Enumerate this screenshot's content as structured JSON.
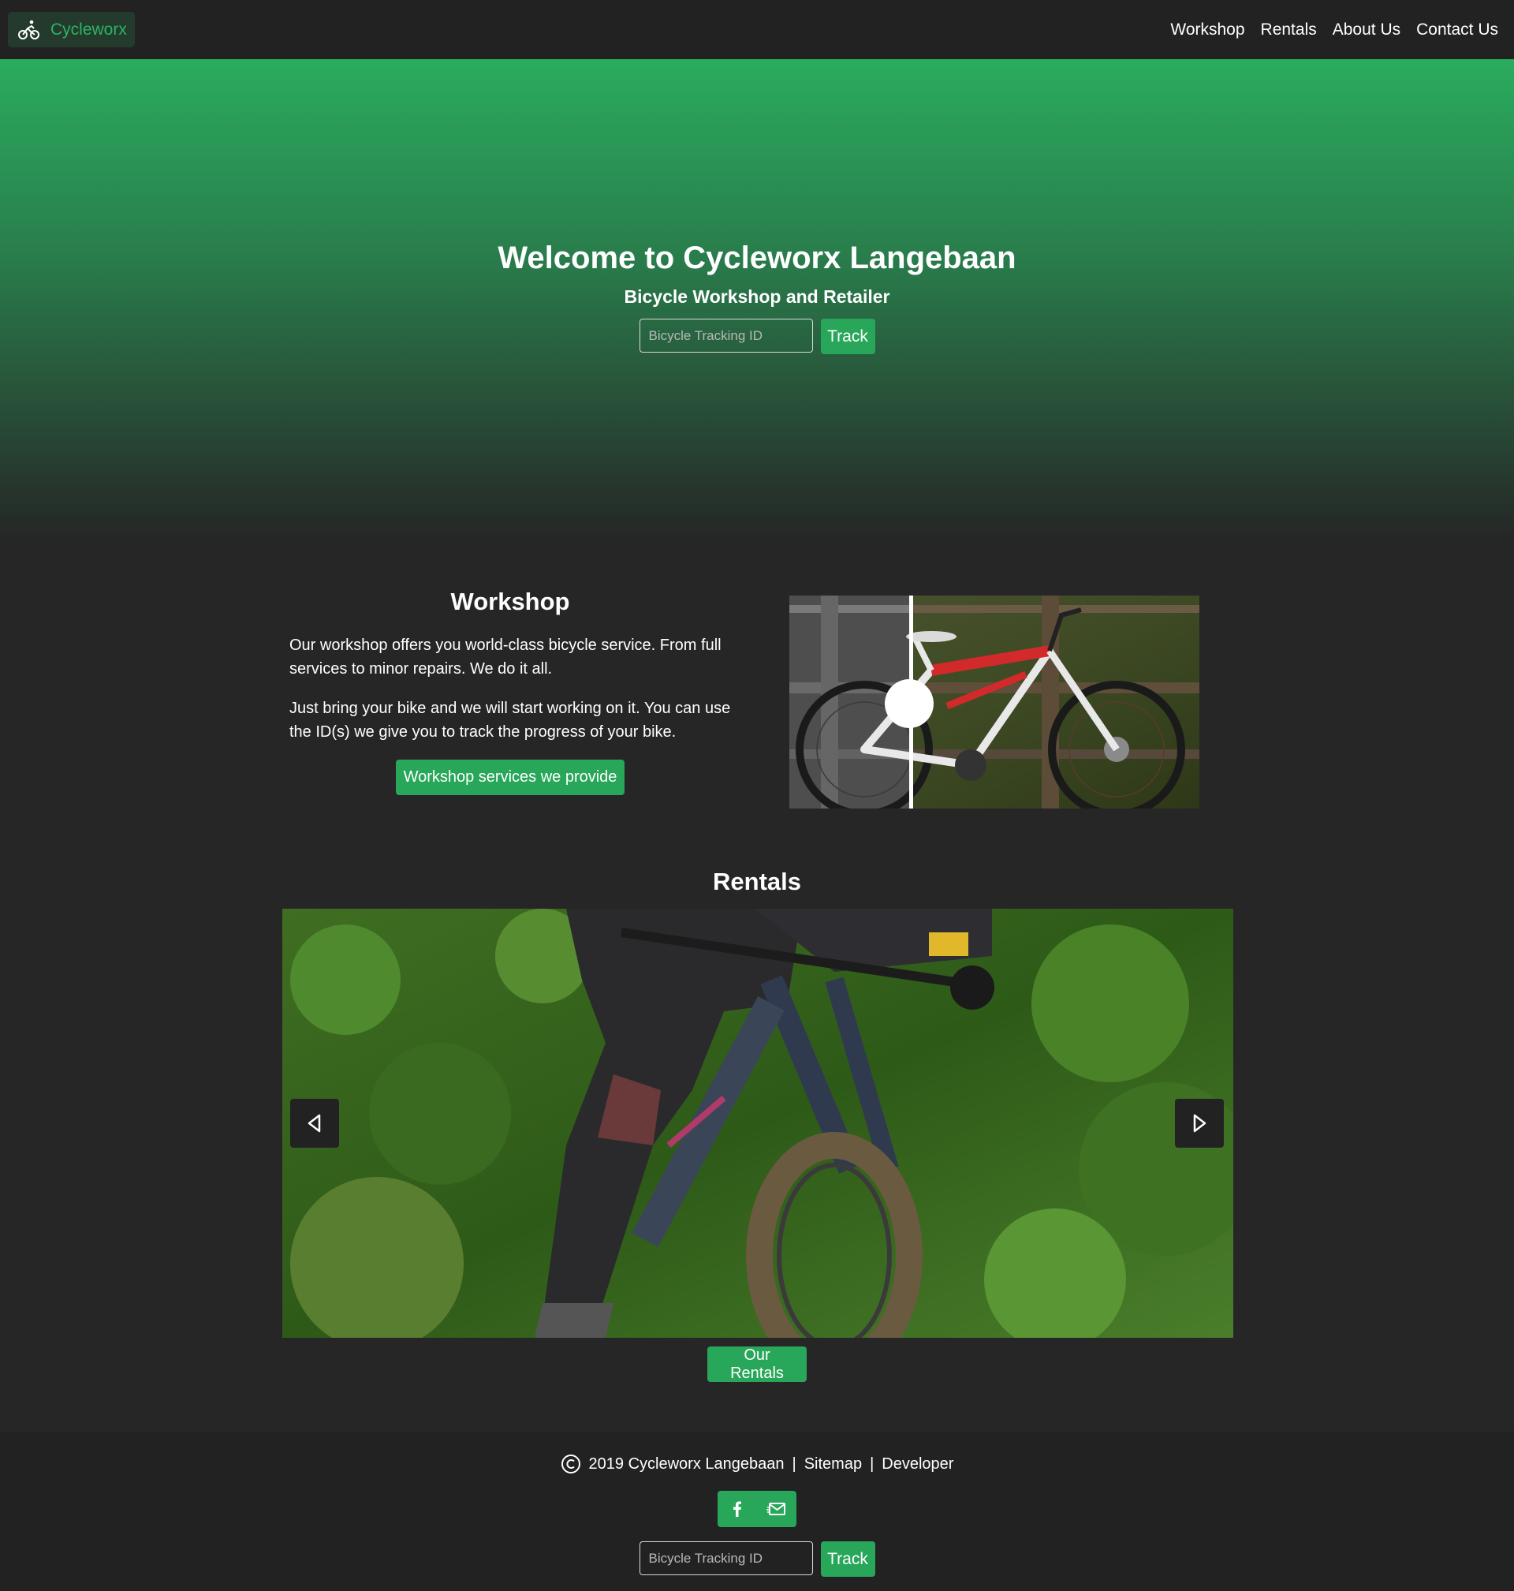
{
  "navbar": {
    "brand": "Cycleworx",
    "brand_icon": "bicycle-icon",
    "links": [
      "Workshop",
      "Rentals",
      "About Us",
      "Contact Us"
    ]
  },
  "hero": {
    "title": "Welcome to Cycleworx Langebaan",
    "subtitle": "Bicycle Workshop and Retailer",
    "tracking_placeholder": "Bicycle Tracking ID",
    "track_label": "Track"
  },
  "workshop": {
    "title": "Workshop",
    "paragraph1": "Our workshop offers you world-class bicycle service. From full services to minor repairs. We do it all.",
    "paragraph2": "Just bring your bike and we will start working on it. You can use the ID(s) we give you to track the progress of your bike.",
    "button_label": "Workshop services we provide"
  },
  "rentals": {
    "title": "Rentals",
    "button_label": "Our Rentals",
    "prev_icon": "chevron-left-icon",
    "next_icon": "chevron-right-icon"
  },
  "footer": {
    "copyright": "2019 Cycleworx Langebaan",
    "separator": "|",
    "sitemap": "Sitemap",
    "developer": "Developer",
    "social_icons": [
      "facebook-icon",
      "email-icon"
    ],
    "tracking_placeholder": "Bicycle Tracking ID",
    "track_label": "Track"
  },
  "colors": {
    "accent": "#28a659",
    "background": "#262626",
    "navbar": "#222222"
  }
}
